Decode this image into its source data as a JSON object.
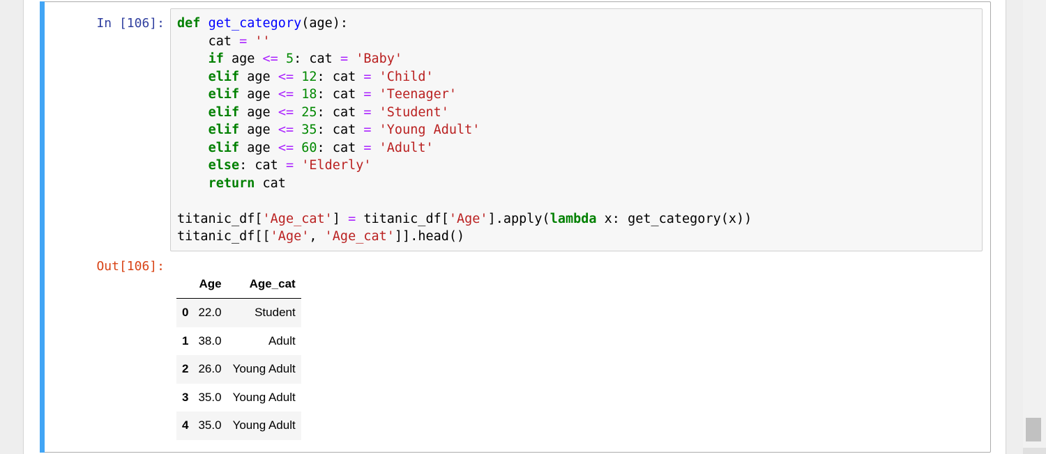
{
  "in_prompt": "In [106]:",
  "out_prompt": "Out[106]:",
  "code_tokens": {
    "def": "def",
    "get_category": "get_category",
    "paren_age": "(age):",
    "cat_assign": "cat",
    "eq": "=",
    "empty_str": "''",
    "if": "if",
    "elif": "elif",
    "else": "else",
    "return": "return",
    "lambda": "lambda",
    "age": "age",
    "le": "<=",
    "cat": "cat",
    "colon": ":",
    "n5": "5",
    "n12": "12",
    "n18": "18",
    "n25": "25",
    "n35": "35",
    "n60": "60",
    "s_baby": "'Baby'",
    "s_child": "'Child'",
    "s_teen": "'Teenager'",
    "s_student": "'Student'",
    "s_young": "'Young Adult'",
    "s_adult": "'Adult'",
    "s_elder": "'Elderly'",
    "tdf": "titanic_df",
    "s_agecat": "'Age_cat'",
    "s_age": "'Age'",
    "apply": ".apply(",
    "x_call": " x: get_category(x))",
    "head": ".head()"
  },
  "table": {
    "columns": [
      "Age",
      "Age_cat"
    ],
    "rows": [
      {
        "index": "0",
        "age": "22.0",
        "age_cat": "Student"
      },
      {
        "index": "1",
        "age": "38.0",
        "age_cat": "Adult"
      },
      {
        "index": "2",
        "age": "26.0",
        "age_cat": "Young Adult"
      },
      {
        "index": "3",
        "age": "35.0",
        "age_cat": "Young Adult"
      },
      {
        "index": "4",
        "age": "35.0",
        "age_cat": "Young Adult"
      }
    ]
  },
  "colors": {
    "cell_selected_bar": "#42a5f5",
    "in_prompt": "#303f9f",
    "out_prompt": "#d84315",
    "keyword": "#008000",
    "string": "#ba2121",
    "operator": "#aa22ff",
    "function_name": "#0000ff"
  }
}
